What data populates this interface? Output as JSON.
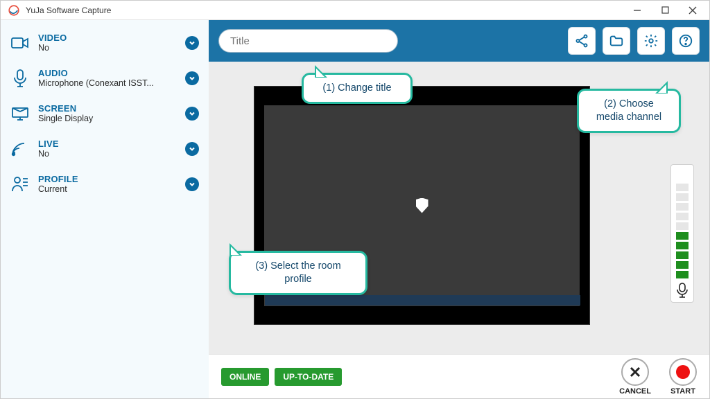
{
  "window": {
    "title": "YuJa Software Capture"
  },
  "sidebar": {
    "items": [
      {
        "label": "VIDEO",
        "value": "No"
      },
      {
        "label": "AUDIO",
        "value": "Microphone (Conexant ISST..."
      },
      {
        "label": "SCREEN",
        "value": "Single Display"
      },
      {
        "label": "LIVE",
        "value": "No"
      },
      {
        "label": "PROFILE",
        "value": "Current"
      }
    ]
  },
  "topbar": {
    "title_placeholder": "Title"
  },
  "status": {
    "online": "ONLINE",
    "update": "UP-TO-DATE"
  },
  "footer": {
    "cancel": "CANCEL",
    "start": "START"
  },
  "meter": {
    "levels_on": 5,
    "levels_total": 10
  },
  "callouts": {
    "c1": "(1) Change title",
    "c2": "(2) Choose media channel",
    "c3": "(3) Select the room profile"
  },
  "colors": {
    "brand_blue": "#0a6aa1",
    "topbar_blue": "#1c73a6",
    "status_green": "#279a2f",
    "callout_teal": "#26b9a0",
    "record_red": "#e11"
  }
}
